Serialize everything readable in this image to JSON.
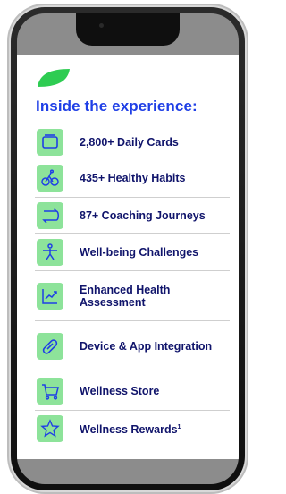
{
  "heading": "Inside the experience:",
  "colors": {
    "heading": "#1f3fe6",
    "label": "#10146b",
    "icon_bg": "#8de39a",
    "icon_stroke": "#1f3fe6",
    "leaf": "#2ecc52"
  },
  "items": [
    {
      "label": "2,800+ Daily Cards",
      "icon": "cards-icon"
    },
    {
      "label": "435+ Healthy Habits",
      "icon": "bicycle-icon"
    },
    {
      "label": "87+ Coaching Journeys",
      "icon": "route-icon"
    },
    {
      "label": "Well-being Challenges",
      "icon": "exercise-icon"
    },
    {
      "label": "Enhanced Health Assessment",
      "icon": "trend-chart-icon"
    },
    {
      "label": "Device & App Integration",
      "icon": "link-icon"
    },
    {
      "label": "Wellness Store",
      "icon": "cart-icon"
    },
    {
      "label": "Wellness Rewards",
      "label_sup": "1",
      "icon": "star-icon"
    }
  ]
}
